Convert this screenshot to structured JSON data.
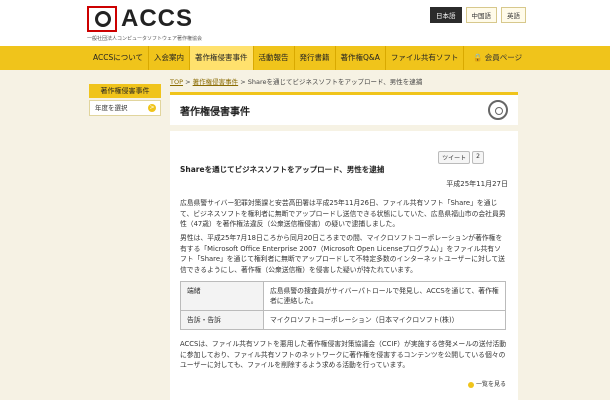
{
  "logo": {
    "name": "ACCS",
    "subtitle": "一般社団法人コンピュータソフトウェア著作権協会"
  },
  "languages": [
    {
      "label": "日本語",
      "active": true
    },
    {
      "label": "中国語",
      "active": false
    },
    {
      "label": "英語",
      "active": false
    }
  ],
  "nav": {
    "items": [
      "ACCSについて",
      "入会案内",
      "著作権侵害事件",
      "活動報告",
      "発行書籍",
      "著作権Q&A",
      "ファイル共有ソフト"
    ],
    "active_index": 2,
    "member": "会員ページ"
  },
  "sidebar": {
    "heading": "著作権侵害事件",
    "item": "年度を選択",
    "item_arrow": ">"
  },
  "breadcrumb": {
    "top": "TOP",
    "section": "著作権侵害事件",
    "current": "Shareを通じてビジネスソフトをアップロード、男性を逮捕",
    "sep": ">"
  },
  "page": {
    "title": "著作権侵害事件"
  },
  "article": {
    "tweet_label": "ツイート",
    "tweet_count": "2",
    "title": "Shareを通じてビジネスソフトをアップロード、男性を逮捕",
    "date": "平成25年11月27日",
    "p1": "広島県警サイバー犯罪対策課と安芸高田署は平成25年11月26日、ファイル共有ソフト「Share」を通じて、ビジネスソフトを権利者に無断でアップロードし送信できる状態にしていた、広島県福山市の会社員男性（47歳）を著作権法違反（公衆送信権侵害）の疑いで逮捕しました。",
    "p2": "男性は、平成25年7月18日ころから同月20日ころまでの間、マイクロソフトコーポレーションが著作権を有する「Microsoft Office Enterprise 2007（Microsoft Open Licenseプログラム）」をファイル共有ソフト「Share」を通じて権利者に無断でアップロードして不特定多数のインターネットユーザーに対して送信できるようにし、著作権（公衆送信権）を侵害した疑いが持たれています。",
    "table": [
      {
        "key": "端緒",
        "value": "広島県警の捜査員がサイバーパトロールで発見し、ACCSを通じて、著作権者に連絡した。"
      },
      {
        "key": "告訴・告訴",
        "value": "マイクロソフトコーポレーション（日本マイクロソフト(株)）"
      }
    ],
    "p3": "ACCSは、ファイル共有ソフトを悪用した著作権侵害対策協議会（CCIF）が実施する啓発メールの送付活動に参加しており、ファイル共有ソフトのネットワークに著作権を侵害するコンテンツを公開している個々のユーザーに対しても、ファイルを削除するよう求める活動を行っています。",
    "to_top": "一覧を見る"
  },
  "colors": {
    "accent": "#f0c41b",
    "background": "#f6f2e4"
  }
}
